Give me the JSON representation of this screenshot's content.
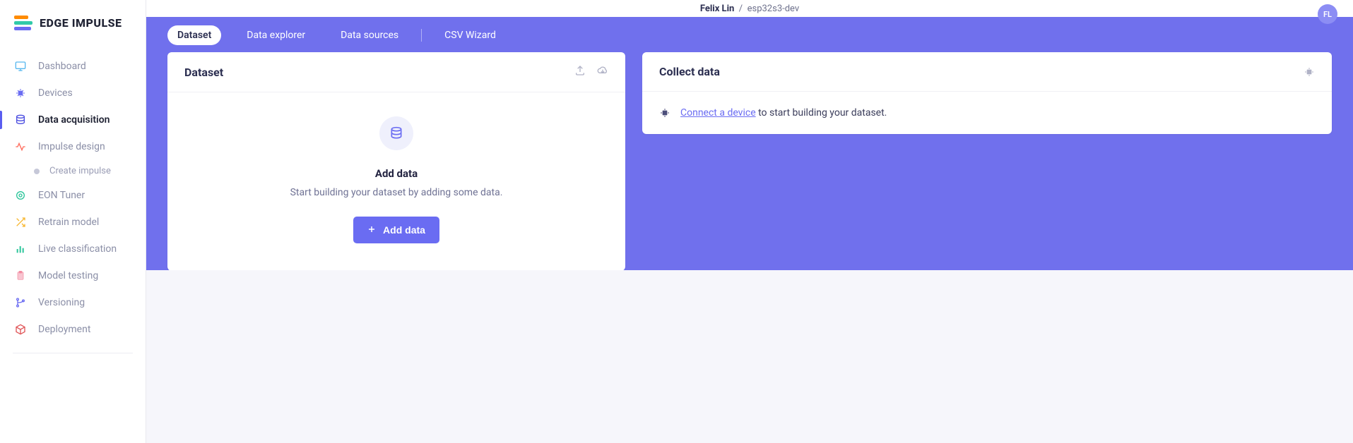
{
  "brand": {
    "name": "EDGE IMPULSE"
  },
  "header": {
    "user": "Felix Lin",
    "project": "esp32s3-dev",
    "avatar_initials": "FL"
  },
  "sidebar": {
    "items": [
      {
        "label": "Dashboard",
        "icon": "monitor"
      },
      {
        "label": "Devices",
        "icon": "chip"
      },
      {
        "label": "Data acquisition",
        "icon": "database",
        "active": true
      },
      {
        "label": "Impulse design",
        "icon": "pulse",
        "children": [
          {
            "label": "Create impulse"
          }
        ]
      },
      {
        "label": "EON Tuner",
        "icon": "target"
      },
      {
        "label": "Retrain model",
        "icon": "shuffle"
      },
      {
        "label": "Live classification",
        "icon": "bars"
      },
      {
        "label": "Model testing",
        "icon": "clipboard"
      },
      {
        "label": "Versioning",
        "icon": "branch"
      },
      {
        "label": "Deployment",
        "icon": "box"
      }
    ]
  },
  "tabs": [
    {
      "label": "Dataset",
      "active": true
    },
    {
      "label": "Data explorer"
    },
    {
      "label": "Data sources"
    },
    {
      "label": "CSV Wizard",
      "separated": true
    }
  ],
  "dataset_card": {
    "title": "Dataset",
    "empty_title": "Add data",
    "empty_subtitle": "Start building your dataset by adding some data.",
    "button_label": "Add data"
  },
  "collect_card": {
    "title": "Collect data",
    "link_text": "Connect a device",
    "rest_text": " to start building your dataset."
  }
}
